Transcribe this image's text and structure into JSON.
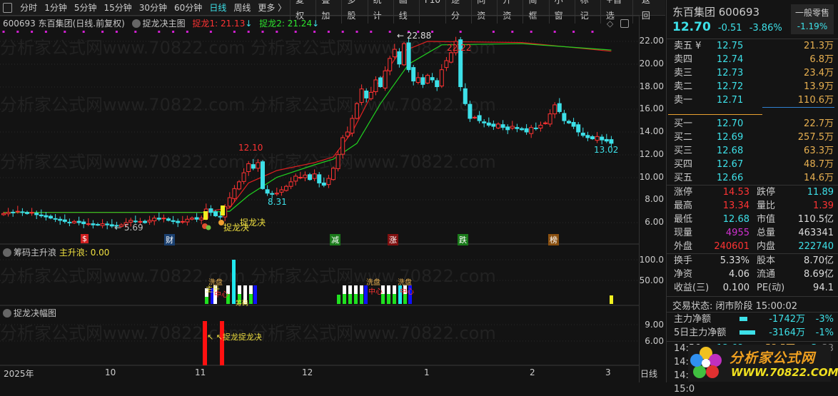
{
  "toolbar": {
    "periods": [
      "分时",
      "1分钟",
      "5分钟",
      "15分钟",
      "30分钟",
      "60分钟",
      "日线",
      "周线",
      "更多 〉"
    ],
    "active": "日线",
    "tools": [
      "复权",
      "叠加",
      "多股",
      "统计",
      "画线",
      "F10",
      "逐分",
      "同资",
      "开资",
      "简框",
      "小窗",
      "标记",
      "+自选",
      "返回"
    ]
  },
  "chart_header": {
    "code_name": "600693 东百集团(日线.前复权)",
    "indicator": "捉龙决主图",
    "line1_label": "捉龙1: 21.13",
    "line2_label": "捉龙2: 21.24",
    "arrow": "↓"
  },
  "price_axis": [
    "22.00",
    "20.00",
    "18.00",
    "16.00",
    "14.00",
    "12.00",
    "10.00",
    "8.00",
    "6.00"
  ],
  "annotations": {
    "high1": "12.10",
    "low1": "8.31",
    "high2": "← 22.88",
    "mid2": "22.22",
    "last": "13.02",
    "low0": "← 5.69",
    "signal1": "捉龙决",
    "signal2": "捉龙决"
  },
  "signals": [
    {
      "t": "$",
      "c": "#d02020"
    },
    {
      "t": "财",
      "c": "#1a4070"
    },
    {
      "t": "减",
      "c": "#1a7a1a"
    },
    {
      "t": "涨",
      "c": "#801010"
    },
    {
      "t": "跌",
      "c": "#1a7a1a"
    },
    {
      "t": "榜",
      "c": "#8a5010"
    }
  ],
  "panel2": {
    "title": "筹码主升浪",
    "value_label": "主升浪: 0.00",
    "axis": [
      "100.0",
      "50.00"
    ],
    "tags": [
      "洗盘",
      "主升",
      "中心",
      "筹码"
    ]
  },
  "panel3": {
    "title": "捉龙决幅图",
    "axis": [
      "9.00",
      "6.00"
    ],
    "tag": "↖ ↖捉龙捉龙决"
  },
  "xaxis": [
    "2025年",
    "10",
    "11",
    "12",
    "1",
    "2",
    "3"
  ],
  "period_label": "日线",
  "colors": {
    "up": "#ff3333",
    "down": "#3de0e8",
    "line1": "#e02020",
    "line2": "#20d020"
  },
  "chart_data": {
    "type": "candlestick",
    "closes": [
      6.8,
      6.9,
      6.9,
      7.0,
      6.9,
      6.8,
      6.9,
      6.7,
      6.6,
      6.5,
      6.4,
      6.3,
      6.2,
      6.1,
      6.0,
      6.1,
      6.0,
      5.9,
      5.9,
      5.8,
      5.8,
      5.9,
      5.8,
      5.7,
      5.7,
      5.8,
      6.0,
      6.2,
      6.1,
      6.1,
      6.0,
      6.2,
      6.4,
      6.3,
      6.4,
      6.2,
      6.1,
      6.0,
      6.1,
      6.3,
      6.4,
      6.3,
      6.4,
      7.2,
      6.9,
      6.6,
      6.5,
      7.4,
      8.2,
      9.0,
      9.6,
      10.4,
      11.2,
      10.8,
      11.3,
      9.0,
      8.6,
      8.5,
      8.6,
      8.9,
      9.2,
      9.6,
      10.1,
      10.0,
      10.2,
      9.8,
      10.3,
      9.5,
      9.3,
      9.9,
      10.8,
      12.0,
      13.5,
      14.0,
      15.2,
      16.5,
      17.8,
      17.0,
      17.5,
      18.6,
      18.0,
      19.4,
      20.5,
      21.3,
      20.0,
      21.8,
      19.5,
      18.5,
      18.8,
      18.2,
      19.0,
      18.6,
      18.0,
      19.5,
      20.3,
      21.0,
      22.0,
      18.0,
      16.5,
      15.2,
      15.3,
      15.0,
      14.8,
      14.6,
      14.5,
      14.7,
      14.4,
      14.2,
      14.5,
      14.3,
      14.2,
      14.0,
      14.4,
      14.3,
      14.6,
      14.8,
      15.6,
      16.4,
      15.8,
      15.0,
      14.8,
      14.5,
      14.0,
      13.7,
      13.5,
      13.4,
      13.6,
      13.3,
      13.2,
      13.0
    ],
    "line1": [
      [
        0,
        6.9
      ],
      [
        42,
        6.9
      ],
      [
        48,
        7.3
      ],
      [
        52,
        9.5
      ],
      [
        58,
        10.6
      ],
      [
        66,
        11.3
      ],
      [
        70,
        11.8
      ],
      [
        74,
        14
      ],
      [
        79,
        18
      ],
      [
        84,
        21
      ],
      [
        90,
        22
      ],
      [
        110,
        21.9
      ],
      [
        129,
        21.13
      ]
    ],
    "line2": [
      [
        0,
        6.9
      ],
      [
        42,
        6.9
      ],
      [
        48,
        7.0
      ],
      [
        52,
        8.4
      ],
      [
        58,
        10.0
      ],
      [
        66,
        11.1
      ],
      [
        70,
        11.6
      ],
      [
        75,
        13
      ],
      [
        80,
        16.5
      ],
      [
        86,
        20
      ],
      [
        93,
        21.7
      ],
      [
        110,
        21.8
      ],
      [
        129,
        21.24
      ]
    ],
    "ylim": [
      6,
      22
    ]
  },
  "right": {
    "name_code": "东百集团 600693",
    "sector": "一般零售",
    "sector_pct": "-1.19%",
    "price": "12.70",
    "change": "-0.51",
    "pct": "-3.86%",
    "asks": [
      [
        "卖五 ¥",
        "12.75",
        "21.3万"
      ],
      [
        "卖四",
        "12.74",
        "6.8万"
      ],
      [
        "卖三",
        "12.73",
        "23.4万"
      ],
      [
        "卖二",
        "12.72",
        "13.9万"
      ],
      [
        "卖一",
        "12.71",
        "110.6万"
      ]
    ],
    "bids": [
      [
        "买一",
        "12.70",
        "22.7万"
      ],
      [
        "买二",
        "12.69",
        "257.5万"
      ],
      [
        "买三",
        "12.68",
        "63.3万"
      ],
      [
        "买四",
        "12.67",
        "48.7万"
      ],
      [
        "买五",
        "12.66",
        "14.6万"
      ]
    ],
    "stats": [
      [
        "涨停",
        "14.53",
        "red",
        "跌停",
        "11.89",
        "cy"
      ],
      [
        "最高",
        "13.34",
        "red",
        "量比",
        "1.39",
        "red"
      ],
      [
        "最低",
        "12.68",
        "cy",
        "市值",
        "110.5亿",
        "wht"
      ],
      [
        "现量",
        "4955",
        "mag",
        "总量",
        "463341",
        "wht"
      ],
      [
        "外盘",
        "240601",
        "red",
        "内盘",
        "222740",
        "cy"
      ]
    ],
    "stats2": [
      [
        "换手",
        "5.33%",
        "股本",
        "8.70亿"
      ],
      [
        "净资",
        "4.06",
        "流通",
        "8.69亿"
      ],
      [
        "收益(三)",
        "0.100",
        "PE(动)",
        "94.1"
      ]
    ],
    "status": "交易状态: 闭市阶段 15:00:02",
    "flows": [
      [
        "主力净额",
        "-1742万",
        "-3%"
      ],
      [
        "5日主力净额",
        "-3164万",
        "-1%"
      ]
    ],
    "ticks": [
      [
        "14:56",
        "12.68",
        "53.5万",
        "S",
        "33"
      ],
      [
        "14:5",
        "",
        "",
        "",
        ""
      ],
      [
        "14:5",
        "",
        "",
        "",
        ""
      ],
      [
        "15:0",
        "",
        "",
        "",
        ""
      ]
    ],
    "logo": {
      "text": "分析家公式网",
      "url": "WWW.70822.COM"
    }
  }
}
